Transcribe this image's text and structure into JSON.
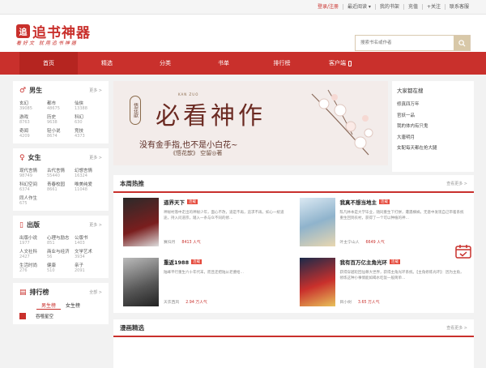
{
  "topbar": {
    "links": [
      "登录/注册",
      "最近阅读 ▾",
      "我的书架",
      "充值",
      "+关注",
      "联系客服"
    ]
  },
  "logo": {
    "mark": "追",
    "text": "追书神器",
    "slogan": "看好文  就用追书神器"
  },
  "search": {
    "placeholder": "搜索书名或作者"
  },
  "nav": {
    "items": [
      "首页",
      "精选",
      "分类",
      "书单",
      "排行榜",
      "客户端"
    ]
  },
  "male": {
    "title": "男生",
    "more": "更多 >",
    "cats": [
      {
        "name": "玄幻",
        "count": "39085"
      },
      {
        "name": "都市",
        "count": "48675"
      },
      {
        "name": "仙侠",
        "count": "13388"
      },
      {
        "name": "游戏",
        "count": "8763"
      },
      {
        "name": "历史",
        "count": "9638"
      },
      {
        "name": "科幻",
        "count": "630"
      },
      {
        "name": "奇闻",
        "count": "4209"
      },
      {
        "name": "轻小说",
        "count": "8674"
      },
      {
        "name": "竞技",
        "count": "4373"
      }
    ]
  },
  "female": {
    "title": "女生",
    "more": "更多 >",
    "cats": [
      {
        "name": "现代言情",
        "count": "98749"
      },
      {
        "name": "古代言情",
        "count": "55440"
      },
      {
        "name": "幻想言情",
        "count": "16324"
      },
      {
        "name": "科幻空间",
        "count": "6374"
      },
      {
        "name": "青春校园",
        "count": "8661"
      },
      {
        "name": "唯美纯爱",
        "count": "11048"
      },
      {
        "name": "同人作生",
        "count": "675"
      }
    ]
  },
  "publish": {
    "title": "出版",
    "more": "更多 >",
    "cats": [
      {
        "name": "出版小说",
        "count": "1977"
      },
      {
        "name": "心理与励志",
        "count": "851"
      },
      {
        "name": "公版书",
        "count": "1403"
      },
      {
        "name": "人文社科",
        "count": "2427"
      },
      {
        "name": "商业与经济",
        "count": "56"
      },
      {
        "name": "文学艺术",
        "count": "3934"
      },
      {
        "name": "生活时尚",
        "count": "276"
      },
      {
        "name": "健康",
        "count": "510"
      },
      {
        "name": "亲子",
        "count": "2091"
      }
    ]
  },
  "rank": {
    "title": "排行榜",
    "more": "全部 >",
    "tabs": [
      "男生榜",
      "女生榜"
    ],
    "first": "吞噬星空"
  },
  "banner": {
    "title": "必看神作",
    "line": "没有金手指,也不是小白花~",
    "sub": "《悟花歆》 空留◎著",
    "tag": "悟花歆",
    "pinyin": "KAN   ZUO"
  },
  "side": {
    "title": "大家都在搜",
    "items": [
      "修真四万年",
      "官妖一品",
      "我的体内有只鬼",
      "大唐明月",
      "女配每天都在抢大腿"
    ]
  },
  "hot": {
    "title": "本周热推",
    "more": "查看更多 >",
    "books": [
      {
        "title": "道界天下",
        "tag": "连载",
        "desc": "神秘村落中走出的神秘少年，面心不改，道是不再，追求不再，如心一统道途，持入问道宗，踏入一条与众不同的修…",
        "author": "赛归月",
        "reads": "8413 人气"
      },
      {
        "title": "我真不想当地主",
        "tag": "连载",
        "desc": "陈凡林本是大学毕业，随同重生下打拼，遭遇横祸，无意中发现自己带着系统重生回到农村，获得了一个可以种植的神…",
        "author": "叶主宁山人",
        "reads": "6649 人气"
      },
      {
        "title": "重返1988",
        "tag": "连载",
        "desc": "陆峰平行重生六十年代末，而且还把陆从老婆给…",
        "author": "天衣西风",
        "reads": "2.94 万人气"
      },
      {
        "title": "我有百万亿主角光环",
        "tag": "连载",
        "desc": "获得穿越轮回仙尊大世界，获得主角光环系统。【主角修炼光环】：因为主角，修炼这种小事情能如喝水吃饭一般简单…",
        "author": "目小树",
        "reads": "3.65 万人气"
      }
    ]
  },
  "comic": {
    "title": "漫画精选",
    "more": "查看更多 >"
  }
}
